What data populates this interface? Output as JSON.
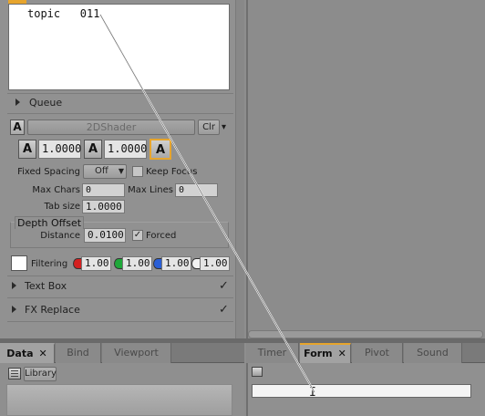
{
  "text_box": {
    "content": "topic   011"
  },
  "queue": {
    "label": "Queue"
  },
  "shader": {
    "name": "2DShader",
    "clear_label": "Clr",
    "dropdown_arrow": "▾"
  },
  "scale": {
    "x_value": "1.0000",
    "y_value": "1.0000"
  },
  "spacing": {
    "fixed_spacing_label": "Fixed Spacing",
    "fixed_spacing_value": "Off",
    "keep_focus_label": "Keep Focus"
  },
  "limits": {
    "max_chars_label": "Max Chars",
    "max_chars_value": "0",
    "max_lines_label": "Max Lines",
    "max_lines_value": "0",
    "tab_size_label": "Tab size",
    "tab_size_value": "1.0000"
  },
  "depth_offset": {
    "title": "Depth Offset",
    "distance_label": "Distance",
    "distance_value": "0.0100",
    "forced_label": "Forced",
    "forced_checked": true
  },
  "filtering": {
    "label": "Filtering",
    "channels": [
      {
        "name": "red-channel",
        "value": "1.00",
        "color": "#d42020"
      },
      {
        "name": "green-channel",
        "value": "1.00",
        "color": "#1fa83a"
      },
      {
        "name": "blue-channel",
        "value": "1.00",
        "color": "#2a5fd6"
      },
      {
        "name": "alpha-channel",
        "value": "1.00",
        "color": "#f2f2f2"
      }
    ]
  },
  "sections": {
    "text_box_label": "Text Box",
    "fx_replace_label": "FX Replace",
    "check_mark": "✓"
  },
  "bottom_left_tabs": [
    {
      "label": "Data",
      "active": true,
      "close": "✕"
    },
    {
      "label": "Bind",
      "active": false
    },
    {
      "label": "Viewport",
      "active": false
    }
  ],
  "bottom_right_tabs": [
    {
      "label": "Timer",
      "active": false
    },
    {
      "label": "Form",
      "active": true,
      "close": "✕"
    },
    {
      "label": "Pivot",
      "active": false
    },
    {
      "label": "Sound",
      "active": false
    }
  ],
  "library": {
    "label": "Library"
  },
  "colors": {
    "accent": "#e7a52d",
    "panel": "#919191",
    "field_white": "#ffffff"
  }
}
